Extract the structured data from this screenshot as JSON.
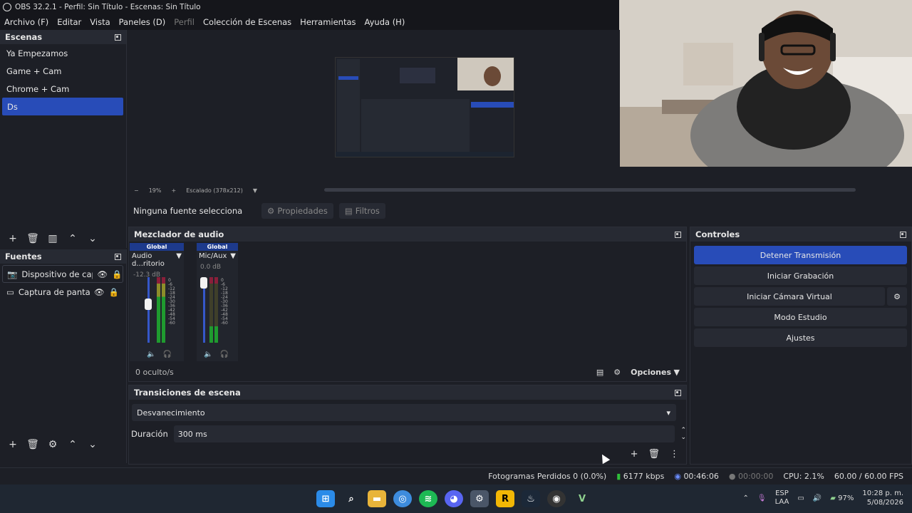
{
  "window": {
    "title": "OBS 32.2.1 - Perfil: Sin Título - Escenas: Sin Título"
  },
  "menu": [
    {
      "label": "Archivo (F)",
      "dim": false
    },
    {
      "label": "Editar",
      "dim": false
    },
    {
      "label": "Vista",
      "dim": false
    },
    {
      "label": "Paneles (D)",
      "dim": false
    },
    {
      "label": "Perfil",
      "dim": true
    },
    {
      "label": "Colección de Escenas",
      "dim": false
    },
    {
      "label": "Herramientas",
      "dim": false
    },
    {
      "label": "Ayuda (H)",
      "dim": false
    }
  ],
  "scenes": {
    "title": "Escenas",
    "items": [
      "Ya Empezamos",
      "Game + Cam",
      "Chrome + Cam",
      "Ds"
    ],
    "selected": "Ds"
  },
  "sources": {
    "title": "Fuentes",
    "items": [
      "Dispositivo de captu",
      "Captura de pantalla"
    ]
  },
  "preview": {
    "zoom": "19%",
    "scale_label": "Escalado (378x212)"
  },
  "source_bar": {
    "no_source": "Ninguna fuente selecciona",
    "properties": "Propiedades",
    "filters": "Filtros"
  },
  "mixer": {
    "title": "Mezclador de audio",
    "channels": [
      {
        "badge": "Global",
        "name": "Audio d...ritorio",
        "db": "-12.3 dB",
        "level": 0.62
      },
      {
        "badge": "Global",
        "name": "Mic/Aux",
        "db": "0.0 dB",
        "level": 0.9
      }
    ],
    "scale": [
      "0",
      "-6",
      "-12",
      "-18",
      "-24",
      "-30",
      "-36",
      "-42",
      "-48",
      "-54",
      "-60"
    ],
    "hidden": "0 oculto/s",
    "options": "Opciones"
  },
  "transitions": {
    "title": "Transiciones de escena",
    "selected": "Desvanecimiento",
    "duration_label": "Duración",
    "duration_value": "300 ms"
  },
  "controls": {
    "title": "Controles",
    "stop_stream": "Detener Transmisión",
    "start_recording": "Iniciar Grabación",
    "virtual_cam": "Iniciar Cámara Virtual",
    "studio_mode": "Modo Estudio",
    "settings": "Ajustes"
  },
  "status": {
    "dropped": "Fotogramas Perdidos 0 (0.0%)",
    "bitrate": "6177 kbps",
    "stream_time": "00:46:06",
    "rec_time": "00:00:00",
    "cpu": "CPU: 2.1%",
    "fps": "60.00 / 60.00 FPS"
  },
  "taskbar": {
    "lang1": "ESP",
    "lang2": "LAA",
    "battery": "97%",
    "time": "10:28 p. m.",
    "date": "5/08/2026"
  }
}
